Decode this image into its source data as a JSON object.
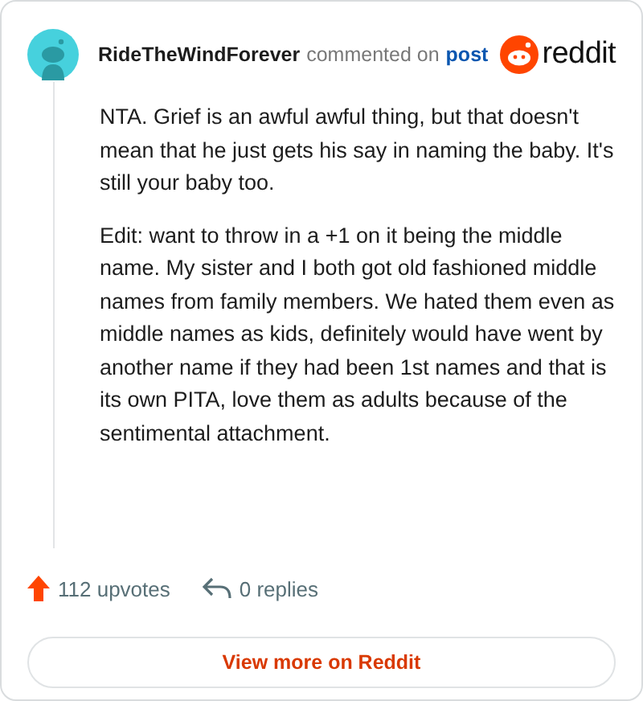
{
  "comment": {
    "author": "RideTheWindForever",
    "action": "commented on",
    "link": "post",
    "brand": "reddit",
    "paragraphs": [
      "NTA. Grief is an awful awful thing, but that doesn't mean that he just gets his say in naming the baby. It's still your baby too.",
      "Edit: want to throw in a +1 on it being the middle name. My sister and I both got old fashioned middle names from family members. We hated them even as middle names as kids, definitely would have went by another name if they had been 1st names and that is its own PITA, love them as adults because of the sentimental attachment."
    ],
    "upvotes": "112 upvotes",
    "replies": "0 replies"
  },
  "button": "View more on Reddit"
}
